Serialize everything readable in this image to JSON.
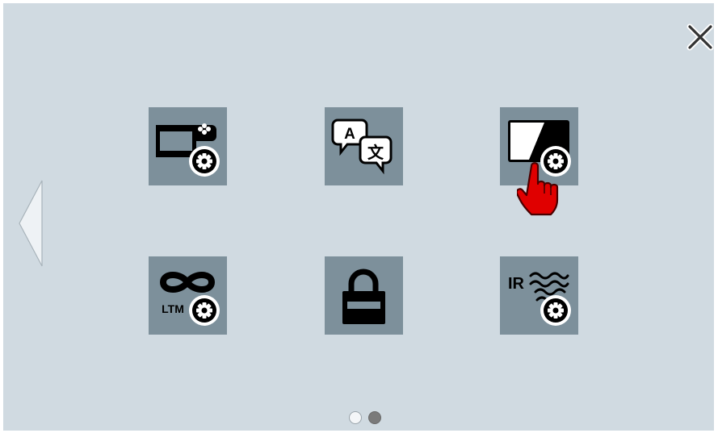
{
  "colors": {
    "background": "#d0dae1",
    "tile": "#7d909b",
    "icon": "#000000",
    "pointer_hand": "#e00000",
    "dot_active": "#7a7a7a",
    "dot_inactive": "#ffffff"
  },
  "close_button": {
    "icon": "close-icon"
  },
  "back_button": {
    "icon": "chevron-left-icon"
  },
  "tiles": [
    {
      "icon": "game-mode-settings-icon",
      "label_text": ""
    },
    {
      "icon": "language-translate-icon",
      "label_text": "A 文"
    },
    {
      "icon": "picture-mode-settings-icon",
      "label_text": ""
    },
    {
      "icon": "ltm-settings-icon",
      "label_text": "LTM"
    },
    {
      "icon": "lock-icon",
      "label_text": ""
    },
    {
      "icon": "ir-settings-icon",
      "label_text": "IR"
    }
  ],
  "pagination": {
    "pages": 2,
    "current": 2
  }
}
